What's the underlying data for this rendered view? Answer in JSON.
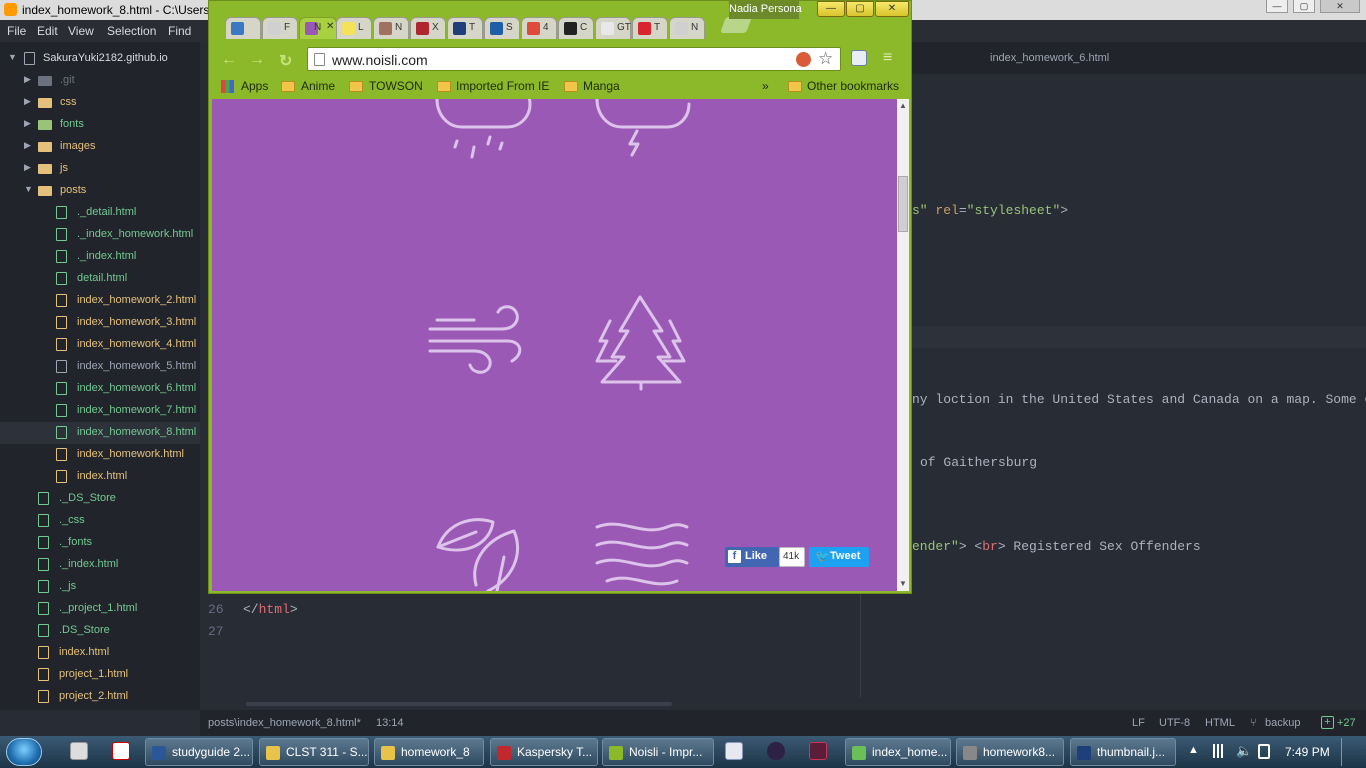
{
  "editor": {
    "title": "index_homework_8.html - C:\\Users\\",
    "menu": [
      "File",
      "Edit",
      "View",
      "Selection",
      "Find"
    ],
    "project_root": "SakuraYuki2182.github.io",
    "tree": [
      {
        "label": ".git",
        "type": "folder"
      },
      {
        "label": "css",
        "type": "folder"
      },
      {
        "label": "fonts",
        "type": "folder"
      },
      {
        "label": "images",
        "type": "folder"
      },
      {
        "label": "js",
        "type": "folder"
      },
      {
        "label": "posts",
        "type": "folder"
      },
      {
        "label": "._detail.html",
        "type": "file"
      },
      {
        "label": "._index_homework.html",
        "type": "file"
      },
      {
        "label": "._index.html",
        "type": "file"
      },
      {
        "label": "detail.html",
        "type": "file"
      },
      {
        "label": "index_homework_2.html",
        "type": "file"
      },
      {
        "label": "index_homework_3.html",
        "type": "file"
      },
      {
        "label": "index_homework_4.html",
        "type": "file"
      },
      {
        "label": "index_homework_5.html",
        "type": "file"
      },
      {
        "label": "index_homework_6.html",
        "type": "file"
      },
      {
        "label": "index_homework_7.html",
        "type": "file"
      },
      {
        "label": "index_homework_8.html",
        "type": "file"
      },
      {
        "label": "index_homework.html",
        "type": "file"
      },
      {
        "label": "index.html",
        "type": "file"
      },
      {
        "label": "._DS_Store",
        "type": "file"
      },
      {
        "label": "._css",
        "type": "file"
      },
      {
        "label": "._fonts",
        "type": "file"
      },
      {
        "label": "._index.html",
        "type": "file"
      },
      {
        "label": "._js",
        "type": "file"
      },
      {
        "label": "._project_1.html",
        "type": "file"
      },
      {
        "label": ".DS_Store",
        "type": "file"
      },
      {
        "label": "index.html",
        "type": "file"
      },
      {
        "label": "project_1.html",
        "type": "file"
      },
      {
        "label": "project_2.html",
        "type": "file"
      }
    ],
    "right_tab": "index_homework_6.html",
    "code_lines": {
      "l26_num": "26",
      "l26_text": "</html>",
      "l27_num": "27",
      "right_1": "s\" rel=\"stylesheet\">",
      "right_2": "ny loction in the United States and Canada on a map. Some o",
      "right_3": "of Gaithersburg",
      "right_4": "ender\"> <br> Registered Sex Offenders"
    },
    "status": {
      "path": "posts\\index_homework_8.html*",
      "cursor": "13:14",
      "eol": "LF",
      "encoding": "UTF-8",
      "grammar": "HTML",
      "branch": "backup",
      "diff": "+27"
    }
  },
  "browser": {
    "url": "www.noisli.com",
    "profile": "Nadia Persona",
    "tabs": [
      {
        "label": "",
        "color": "#3b78c4"
      },
      {
        "label": "F",
        "color": "#d0d0d0"
      },
      {
        "label": "N",
        "color": "#9b59b6"
      },
      {
        "label": "L",
        "color": "#f5e25a"
      },
      {
        "label": "N",
        "color": "#a07060"
      },
      {
        "label": "X",
        "color": "#b0262e"
      },
      {
        "label": "T",
        "color": "#1f3f7a"
      },
      {
        "label": "S",
        "color": "#1f5fa8"
      },
      {
        "label": "4",
        "color": "#e04a3a"
      },
      {
        "label": "C",
        "color": "#222222"
      },
      {
        "label": "GT L",
        "color": "#e8e8e8"
      },
      {
        "label": "T",
        "color": "#d9262e"
      },
      {
        "label": "N",
        "color": "#d0d0d0"
      }
    ],
    "bookmarks": [
      "Apps",
      "Anime",
      "TOWSON",
      "Imported From IE",
      "Manga"
    ],
    "bookmarks_more": "»",
    "other_bookmarks": "Other bookmarks",
    "page": {
      "like": "Like",
      "like_count": "41k",
      "tweet": "Tweet"
    }
  },
  "taskbar": {
    "items": [
      {
        "label": "studyguide 2...",
        "color": "#2b5797"
      },
      {
        "label": "CLST 311 - S...",
        "color": "#e8c34a"
      },
      {
        "label": "homework_8",
        "color": "#e8c34a"
      },
      {
        "label": "Kaspersky T...",
        "color": "#c0282e"
      },
      {
        "label": "Noisli - Impr...",
        "color": "#8cb92a"
      },
      {
        "label": "index_home...",
        "color": "#6bbf59"
      },
      {
        "label": "homework8...",
        "color": "#888888"
      },
      {
        "label": "thumbnail.j...",
        "color": "#1f3f7a"
      }
    ],
    "clock": "7:49 PM"
  },
  "colors": {
    "noisli_purple": "#9b59b6",
    "browser_frame": "#8cb92a",
    "editor_bg": "#282c34",
    "sidebar_bg": "#21252b"
  }
}
